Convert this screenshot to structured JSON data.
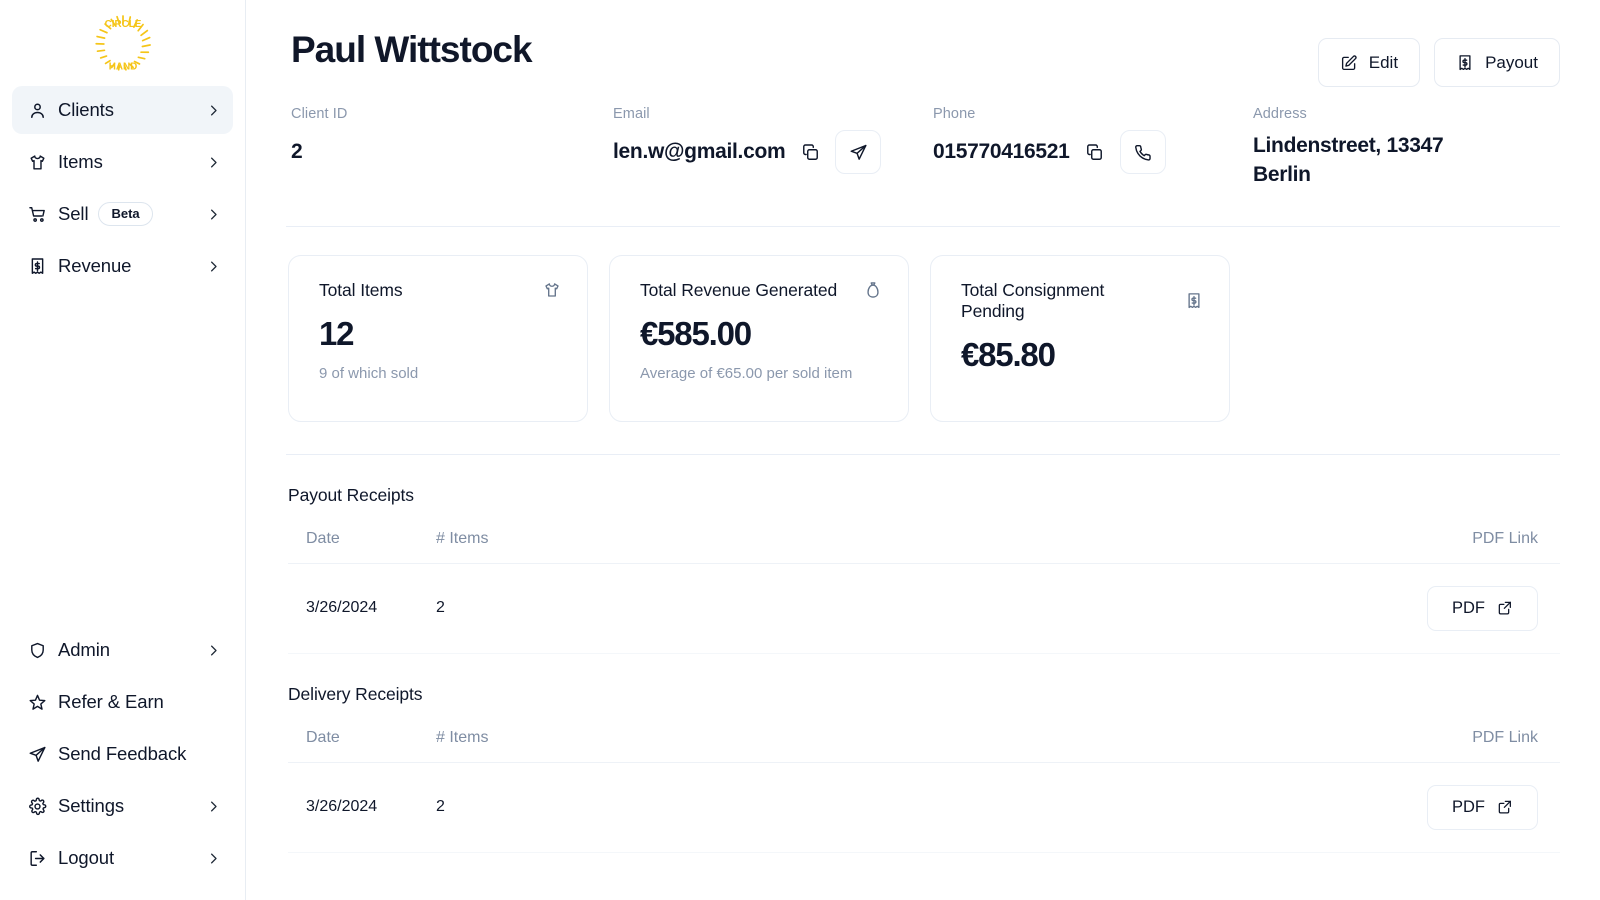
{
  "brand": {
    "logo_text_top": "CIRCLE",
    "logo_text_bottom": "HAND",
    "logo_color": "#f5c518"
  },
  "sidebar": {
    "top_items": [
      {
        "label": "Clients",
        "icon": "user-icon",
        "active": true,
        "has_chevron": true,
        "badge": null
      },
      {
        "label": "Items",
        "icon": "tshirt-icon",
        "active": false,
        "has_chevron": true,
        "badge": null
      },
      {
        "label": "Sell",
        "icon": "cart-icon",
        "active": false,
        "has_chevron": true,
        "badge": "Beta"
      },
      {
        "label": "Revenue",
        "icon": "receipt-dollar-icon",
        "active": false,
        "has_chevron": true,
        "badge": null
      }
    ],
    "bottom_items": [
      {
        "label": "Admin",
        "icon": "shield-icon",
        "has_chevron": true
      },
      {
        "label": "Refer & Earn",
        "icon": "star-icon",
        "has_chevron": false
      },
      {
        "label": "Send Feedback",
        "icon": "send-icon",
        "has_chevron": false
      },
      {
        "label": "Settings",
        "icon": "gear-icon",
        "has_chevron": true
      },
      {
        "label": "Logout",
        "icon": "logout-icon",
        "has_chevron": true
      }
    ]
  },
  "header": {
    "title": "Paul Wittstock",
    "edit_label": "Edit",
    "payout_label": "Payout"
  },
  "info": {
    "client_id_label": "Client ID",
    "client_id_value": "2",
    "email_label": "Email",
    "email_value": "len.w@gmail.com",
    "phone_label": "Phone",
    "phone_value": "015770416521",
    "address_label": "Address",
    "address_line1": "Lindenstreet, 13347",
    "address_line2": "Berlin"
  },
  "cards": [
    {
      "title": "Total Items",
      "value": "12",
      "sub": "9 of which sold",
      "icon": "tshirt-icon"
    },
    {
      "title": "Total Revenue Generated",
      "value": "€585.00",
      "sub": "Average of €65.00 per sold item",
      "icon": "money-bag-icon"
    },
    {
      "title": "Total Consignment Pending",
      "value": "€85.80",
      "sub": "",
      "icon": "receipt-dollar-icon"
    }
  ],
  "payout_receipts": {
    "title": "Payout Receipts",
    "columns": [
      "Date",
      "# Items",
      "PDF Link"
    ],
    "rows": [
      {
        "date": "3/26/2024",
        "items": "2",
        "pdf_label": "PDF"
      }
    ]
  },
  "delivery_receipts": {
    "title": "Delivery Receipts",
    "columns": [
      "Date",
      "# Items",
      "PDF Link"
    ],
    "rows": [
      {
        "date": "3/26/2024",
        "items": "2",
        "pdf_label": "PDF"
      }
    ]
  },
  "colors": {
    "accent": "#f5c518",
    "text": "#0f172a",
    "muted": "#8b98ad",
    "border": "#e9eef5",
    "active_bg": "#f1f5f9"
  }
}
